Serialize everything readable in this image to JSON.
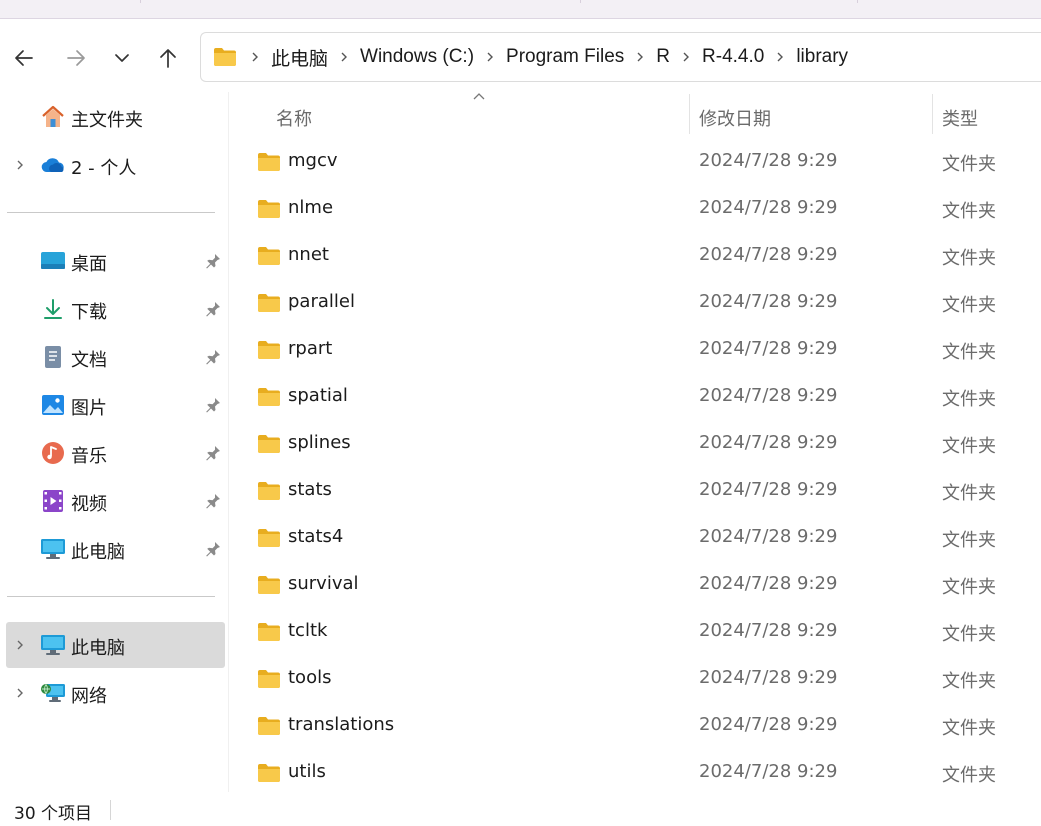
{
  "navigation": {
    "back_icon": "arrow-left-icon",
    "forward_icon": "arrow-right-icon",
    "recent_icon": "chevron-down-icon",
    "up_icon": "arrow-up-icon"
  },
  "address_bar": {
    "root_icon": "folder-icon",
    "breadcrumbs": [
      "此电脑",
      "Windows (C:)",
      "Program Files",
      "R",
      "R-4.4.0",
      "library"
    ]
  },
  "sidebar": {
    "quick": [
      {
        "label": "主文件夹",
        "icon": "home-icon"
      },
      {
        "label": "2 - 个人",
        "icon": "onedrive-cloud-icon",
        "expandable": true
      }
    ],
    "pinned": [
      {
        "label": "桌面",
        "icon": "desktop-icon"
      },
      {
        "label": "下载",
        "icon": "download-icon"
      },
      {
        "label": "文档",
        "icon": "documents-icon"
      },
      {
        "label": "图片",
        "icon": "pictures-icon"
      },
      {
        "label": "音乐",
        "icon": "music-icon"
      },
      {
        "label": "视频",
        "icon": "videos-icon"
      },
      {
        "label": "此电脑",
        "icon": "this-pc-icon"
      }
    ],
    "devices": [
      {
        "label": "此电脑",
        "icon": "this-pc-icon",
        "selected": true
      },
      {
        "label": "网络",
        "icon": "network-icon"
      }
    ]
  },
  "columns": {
    "name": "名称",
    "date": "修改日期",
    "type": "类型"
  },
  "files": [
    {
      "name": "mgcv",
      "date": "2024/7/28 9:29",
      "type": "文件夹"
    },
    {
      "name": "nlme",
      "date": "2024/7/28 9:29",
      "type": "文件夹"
    },
    {
      "name": "nnet",
      "date": "2024/7/28 9:29",
      "type": "文件夹"
    },
    {
      "name": "parallel",
      "date": "2024/7/28 9:29",
      "type": "文件夹"
    },
    {
      "name": "rpart",
      "date": "2024/7/28 9:29",
      "type": "文件夹"
    },
    {
      "name": "spatial",
      "date": "2024/7/28 9:29",
      "type": "文件夹"
    },
    {
      "name": "splines",
      "date": "2024/7/28 9:29",
      "type": "文件夹"
    },
    {
      "name": "stats",
      "date": "2024/7/28 9:29",
      "type": "文件夹"
    },
    {
      "name": "stats4",
      "date": "2024/7/28 9:29",
      "type": "文件夹"
    },
    {
      "name": "survival",
      "date": "2024/7/28 9:29",
      "type": "文件夹"
    },
    {
      "name": "tcltk",
      "date": "2024/7/28 9:29",
      "type": "文件夹"
    },
    {
      "name": "tools",
      "date": "2024/7/28 9:29",
      "type": "文件夹"
    },
    {
      "name": "translations",
      "date": "2024/7/28 9:29",
      "type": "文件夹"
    },
    {
      "name": "utils",
      "date": "2024/7/28 9:29",
      "type": "文件夹"
    }
  ],
  "status": {
    "item_count": "30 个项目"
  },
  "colors": {
    "folder": "#f8c94a",
    "folder_dark": "#e8ad1f",
    "selected_bg": "#dadada",
    "accent": "#0067c0"
  }
}
